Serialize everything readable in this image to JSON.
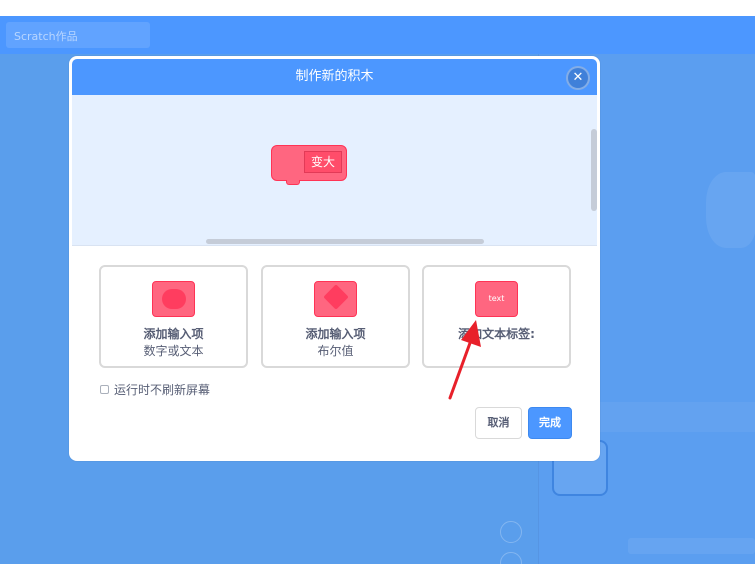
{
  "app": {
    "project_title": "Scratch作品"
  },
  "dialog": {
    "title": "制作新的积木",
    "close_icon": "close-icon",
    "block_name": "变大",
    "options": [
      {
        "title": "添加输入项",
        "subtitle": "数字或文本",
        "icon": "number-text-input-icon"
      },
      {
        "title": "添加输入项",
        "subtitle": "布尔值",
        "icon": "boolean-input-icon"
      },
      {
        "title": "添加文本标签:",
        "subtitle": "",
        "icon": "text-label-icon",
        "chip": "text"
      }
    ],
    "checkbox_label": "运行时不刷新屏幕",
    "cancel_label": "取消",
    "ok_label": "完成"
  },
  "colors": {
    "accent": "#4c97ff",
    "block": "#ff6680",
    "annotation_arrow": "#e8202a"
  }
}
